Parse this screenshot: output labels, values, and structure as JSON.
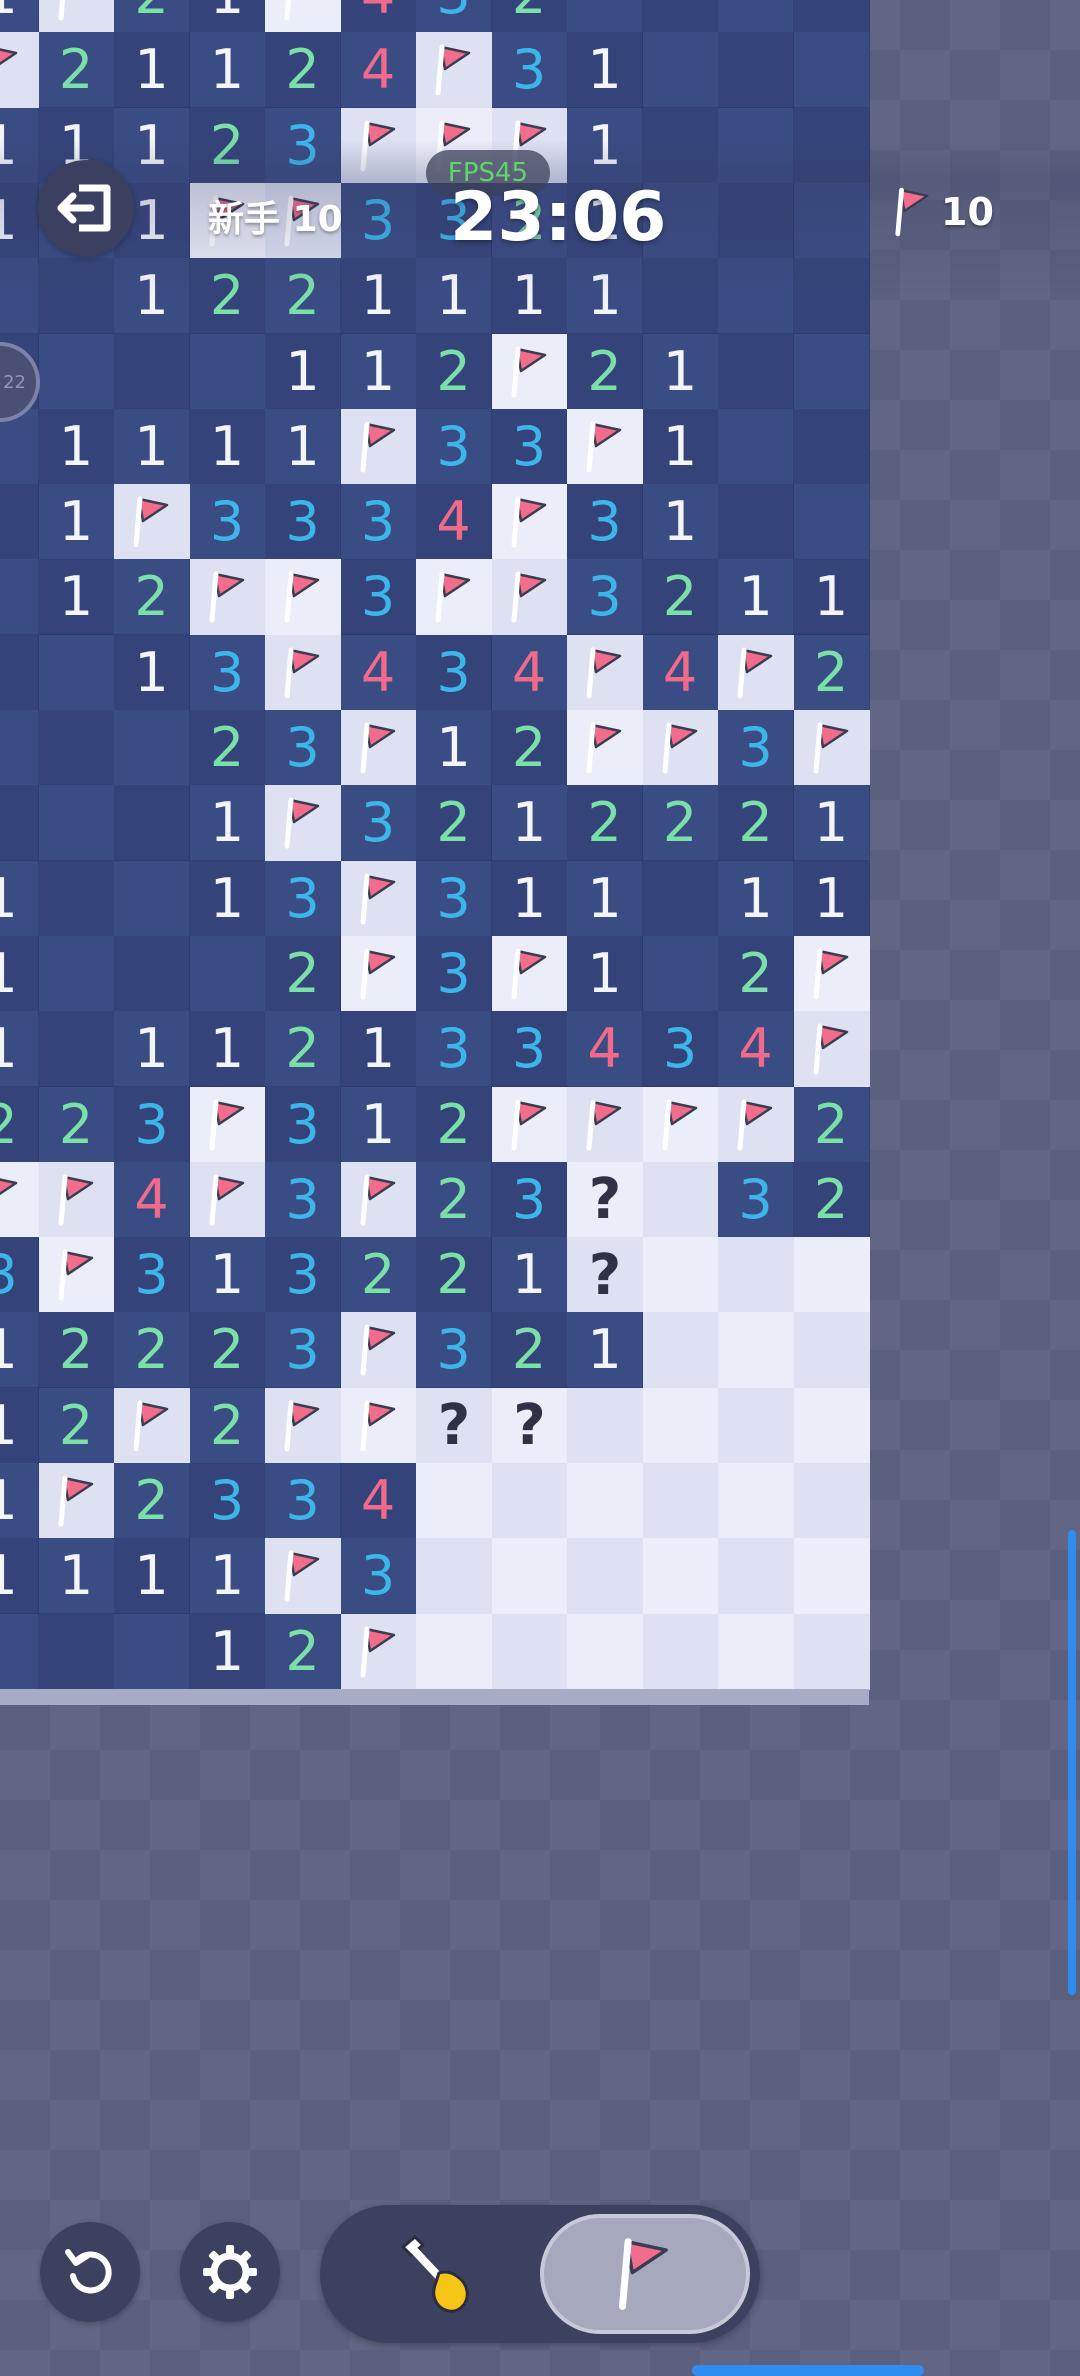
{
  "header": {
    "difficulty": "新手 10",
    "fps": "FPS45",
    "timer": "23:06",
    "flags_remaining": "10"
  },
  "side_badge": "22",
  "colors": {
    "closed_dark": "#34447a",
    "closed_light": "#3a4c84",
    "open_light": "#ebedf8",
    "open_dark": "#dde1f2",
    "num1": "#f4f5fb",
    "num2": "#7be0a8",
    "num3": "#3cb6ea",
    "num4": "#f06a8a",
    "flag": "#f26d8c",
    "timer_text": "#ffffff",
    "fps_text": "#5fd56b",
    "accent_blue": "#2f8cf0"
  },
  "board": {
    "rows": [
      [
        "1",
        "F",
        "2",
        "1",
        "F",
        "4",
        "3",
        "2",
        ".",
        ".",
        ".",
        "."
      ],
      [
        "F",
        "2",
        "1",
        "1",
        "2",
        "4",
        "F",
        "3",
        "1",
        ".",
        ".",
        "."
      ],
      [
        "1",
        "1",
        "1",
        "2",
        "3",
        "F",
        "F",
        "F",
        "1",
        ".",
        ".",
        "."
      ],
      [
        "1",
        "1",
        "1",
        "F",
        "F",
        "3",
        "3",
        "2",
        "1",
        ".",
        ".",
        "."
      ],
      [
        ".",
        ".",
        "1",
        "2",
        "2",
        "1",
        "1",
        "1",
        "1",
        ".",
        ".",
        "."
      ],
      [
        "2",
        ".",
        ".",
        ".",
        "1",
        "1",
        "2",
        "F",
        "2",
        "1",
        ".",
        "."
      ],
      [
        ".",
        "1",
        "1",
        "1",
        "1",
        "F",
        "3",
        "3",
        "F",
        "1",
        ".",
        "."
      ],
      [
        ".",
        "1",
        "F",
        "3",
        "3",
        "3",
        "4",
        "F",
        "3",
        "1",
        ".",
        "."
      ],
      [
        ".",
        "1",
        "2",
        "F",
        "F",
        "3",
        "F",
        "F",
        "3",
        "2",
        "1",
        "1"
      ],
      [
        ".",
        ".",
        "1",
        "3",
        "F",
        "4",
        "3",
        "4",
        "F",
        "4",
        "F",
        "2"
      ],
      [
        ".",
        ".",
        ".",
        "2",
        "3",
        "F",
        "1",
        "2",
        "F",
        "F",
        "3",
        "F"
      ],
      [
        ".",
        ".",
        ".",
        "1",
        "F",
        "3",
        "2",
        "1",
        "2",
        "2",
        "2",
        "1"
      ],
      [
        "1",
        ".",
        ".",
        "1",
        "3",
        "F",
        "3",
        "1",
        "1",
        ".",
        "1",
        "1"
      ],
      [
        "1",
        ".",
        ".",
        ".",
        "2",
        "F",
        "3",
        "F",
        "1",
        ".",
        "2",
        "F"
      ],
      [
        "1",
        ".",
        "1",
        "1",
        "2",
        "1",
        "3",
        "3",
        "4",
        "3",
        "4",
        "F"
      ],
      [
        "2",
        "2",
        "3",
        "F",
        "3",
        "1",
        "2",
        "F",
        "F",
        "F",
        "F",
        "2"
      ],
      [
        "F",
        "F",
        "4",
        "F",
        "3",
        "F",
        "2",
        "3",
        "?",
        "o",
        "3",
        "2"
      ],
      [
        "3",
        "F",
        "3",
        "1",
        "3",
        "2",
        "2",
        "1",
        "?",
        "o",
        "o",
        "o"
      ],
      [
        "1",
        "2",
        "2",
        "2",
        "3",
        "F",
        "3",
        "2",
        "1",
        "o",
        "o",
        "o"
      ],
      [
        "1",
        "2",
        "F",
        "2",
        "F",
        "F",
        "?",
        "?",
        "o",
        "o",
        "o",
        "o"
      ],
      [
        "1",
        "F",
        "2",
        "3",
        "3",
        "4",
        "o",
        "o",
        "o",
        "o",
        "o",
        "o"
      ],
      [
        "1",
        "1",
        "1",
        "1",
        "F",
        "3",
        "o",
        "o",
        "o",
        "o",
        "o",
        "o"
      ],
      [
        ".",
        ".",
        ".",
        "1",
        "2",
        "F",
        "o",
        "o",
        "o",
        "o",
        "o",
        "o"
      ]
    ]
  }
}
